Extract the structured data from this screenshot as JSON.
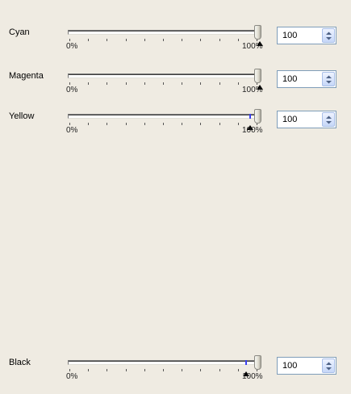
{
  "rows": [
    {
      "key": "cyan",
      "label": "Cyan",
      "value_text": "100",
      "value": 100,
      "min_label": "0%",
      "max_label": "100%",
      "blue_mark": null,
      "marker": 100
    },
    {
      "key": "magenta",
      "label": "Magenta",
      "value_text": "100",
      "value": 100,
      "min_label": "0%",
      "max_label": "100%",
      "blue_mark": null,
      "marker": 100
    },
    {
      "key": "yellow",
      "label": "Yellow",
      "value_text": "100",
      "value": 100,
      "min_label": "0%",
      "max_label": "100%",
      "blue_mark": 95,
      "marker": 95
    },
    {
      "key": "black",
      "label": "Black",
      "value_text": "100",
      "value": 100,
      "min_label": "0%",
      "max_label": "100%",
      "blue_mark": 93,
      "marker": 93
    }
  ],
  "colors": {
    "accent": "#3a3ff0",
    "spin_border": "#7f9db9"
  },
  "icons": {
    "spin": "spin-up-down-icon",
    "thumb": "slider-thumb-icon",
    "marker": "triangle-marker-icon"
  }
}
